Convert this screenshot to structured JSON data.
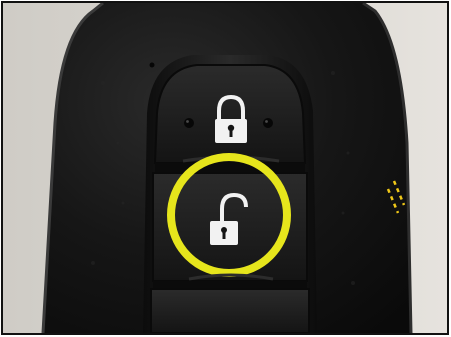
{
  "scene": {
    "background": "#d9d6d0",
    "fob_color": "#141414",
    "button_color": "#1a1a1a",
    "icon_color": "#f2f2f2",
    "highlight_color": "#e6e51c",
    "accent_dash_color": "#f0c818"
  },
  "buttons": [
    {
      "icon": "lock-icon"
    },
    {
      "icon": "unlock-icon",
      "highlighted": true
    },
    {
      "icon": "none"
    }
  ]
}
